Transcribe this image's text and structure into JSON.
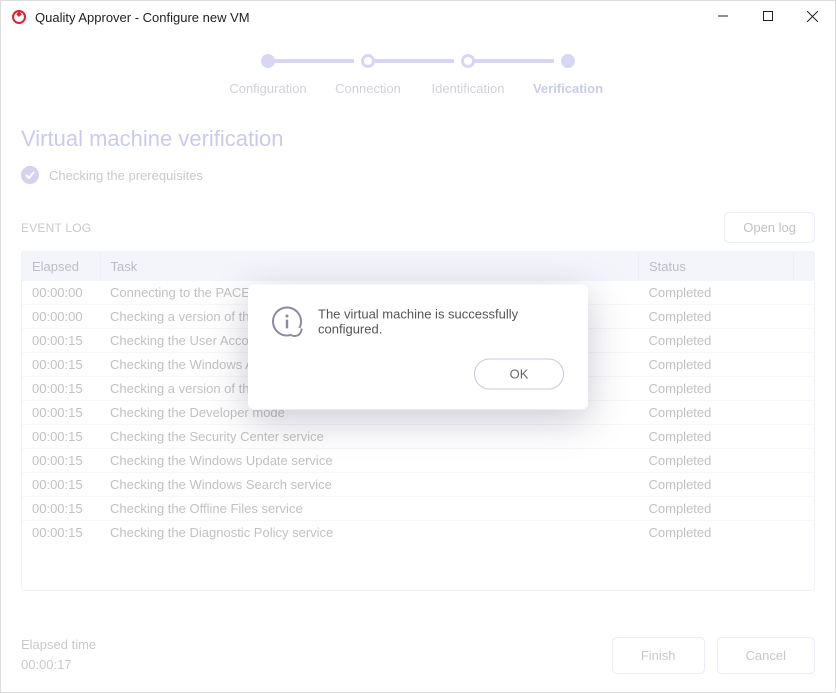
{
  "window": {
    "title": "Quality Approver - Configure new VM"
  },
  "stepper": {
    "steps": [
      {
        "label": "Configuration"
      },
      {
        "label": "Connection"
      },
      {
        "label": "Identification"
      },
      {
        "label": "Verification"
      }
    ]
  },
  "page": {
    "title": "Virtual machine verification",
    "subtitle": "Checking the prerequisites"
  },
  "log": {
    "section_label": "EVENT LOG",
    "open_button": "Open log",
    "columns": {
      "elapsed": "Elapsed",
      "task": "Task",
      "status": "Status"
    },
    "rows": [
      {
        "elapsed": "00:00:00",
        "task": "Connecting to the PACE broker service",
        "status": "Completed"
      },
      {
        "elapsed": "00:00:00",
        "task": "Checking a version of the PACE broker service",
        "status": "Completed"
      },
      {
        "elapsed": "00:00:15",
        "task": "Checking the User Account Control (UAC)",
        "status": "Completed"
      },
      {
        "elapsed": "00:00:15",
        "task": "Checking the Windows Agent service",
        "status": "Completed"
      },
      {
        "elapsed": "00:00:15",
        "task": "Checking a version of the Windows Agent",
        "status": "Completed"
      },
      {
        "elapsed": "00:00:15",
        "task": "Checking the Developer mode",
        "status": "Completed"
      },
      {
        "elapsed": "00:00:15",
        "task": "Checking the Security Center service",
        "status": "Completed"
      },
      {
        "elapsed": "00:00:15",
        "task": "Checking the Windows Update service",
        "status": "Completed"
      },
      {
        "elapsed": "00:00:15",
        "task": "Checking the Windows Search service",
        "status": "Completed"
      },
      {
        "elapsed": "00:00:15",
        "task": "Checking the Offline Files service",
        "status": "Completed"
      },
      {
        "elapsed": "00:00:15",
        "task": "Checking the Diagnostic Policy service",
        "status": "Completed"
      }
    ]
  },
  "footer": {
    "elapsed_label": "Elapsed time",
    "elapsed_value": "00:00:17",
    "finish": "Finish",
    "cancel": "Cancel"
  },
  "dialog": {
    "message": "The virtual machine is successfully configured.",
    "ok": "OK"
  }
}
